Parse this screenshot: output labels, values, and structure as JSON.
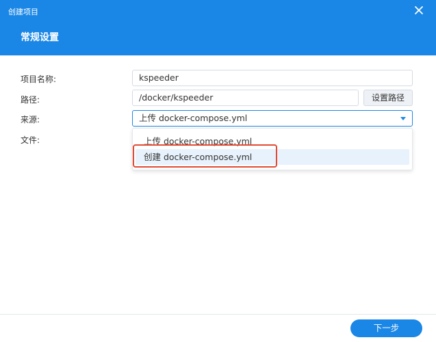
{
  "window": {
    "title": "创建项目",
    "close_icon": "close-icon"
  },
  "header": {
    "section_title": "常规设置"
  },
  "form": {
    "name_label": "项目名称:",
    "name_value": "kspeeder",
    "path_label": "路径:",
    "path_value": "/docker/kspeeder",
    "path_button": "设置路径",
    "source_label": "来源:",
    "source_selected": "上传 docker-compose.yml",
    "source_options": [
      "上传 docker-compose.yml",
      "创建 docker-compose.yml"
    ],
    "file_label": "文件:"
  },
  "footer": {
    "next_button": "下一步"
  },
  "colors": {
    "accent": "#1a87e6",
    "highlight": "#e8f2fc",
    "annotation": "#e34a33"
  }
}
